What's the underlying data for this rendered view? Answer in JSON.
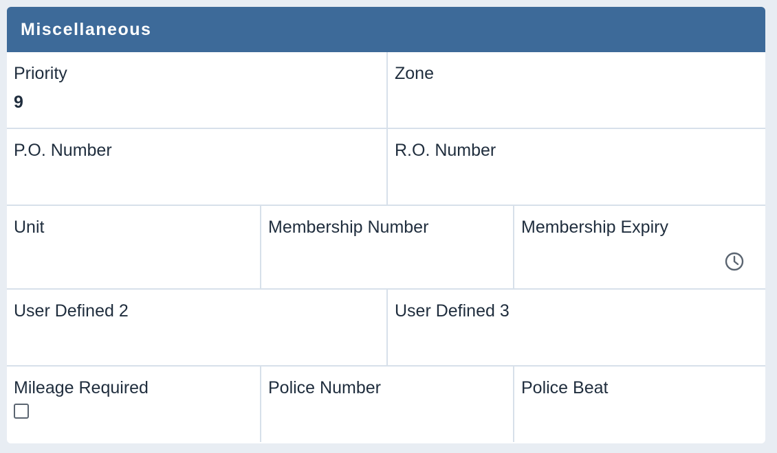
{
  "panel": {
    "title": "Miscellaneous"
  },
  "fields": {
    "priority": {
      "label": "Priority",
      "value": "9"
    },
    "zone": {
      "label": "Zone",
      "value": ""
    },
    "po_number": {
      "label": "P.O. Number",
      "value": ""
    },
    "ro_number": {
      "label": "R.O. Number",
      "value": ""
    },
    "unit": {
      "label": "Unit",
      "value": ""
    },
    "membership_number": {
      "label": "Membership Number",
      "value": ""
    },
    "membership_expiry": {
      "label": "Membership Expiry",
      "value": "",
      "icon": "clock-icon"
    },
    "user_defined_2": {
      "label": "User Defined 2",
      "value": ""
    },
    "user_defined_3": {
      "label": "User Defined 3",
      "value": ""
    },
    "mileage_required": {
      "label": "Mileage Required",
      "checked": false
    },
    "police_number": {
      "label": "Police Number",
      "value": ""
    },
    "police_beat": {
      "label": "Police Beat",
      "value": ""
    }
  },
  "colors": {
    "header_bg": "#3d6a99",
    "header_text": "#ffffff",
    "border": "#d7e0ea",
    "page_bg": "#e8edf3"
  }
}
